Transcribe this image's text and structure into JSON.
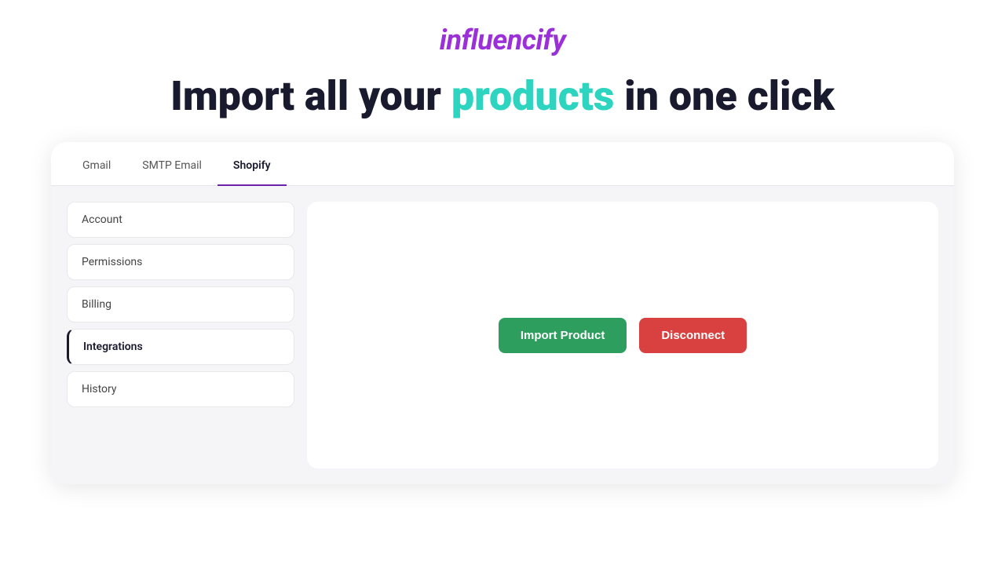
{
  "logo": {
    "text": "influencify"
  },
  "headline": {
    "prefix": "Import all your ",
    "highlight": "products",
    "suffix": " in one click"
  },
  "tabs": [
    {
      "label": "Gmail",
      "active": false
    },
    {
      "label": "SMTP Email",
      "active": false
    },
    {
      "label": "Shopify",
      "active": true
    }
  ],
  "sidebar": {
    "items": [
      {
        "label": "Account",
        "active": false
      },
      {
        "label": "Permissions",
        "active": false
      },
      {
        "label": "Billing",
        "active": false
      },
      {
        "label": "Integrations",
        "active": true
      },
      {
        "label": "History",
        "active": false
      }
    ]
  },
  "buttons": {
    "import": "Import Product",
    "disconnect": "Disconnect"
  }
}
